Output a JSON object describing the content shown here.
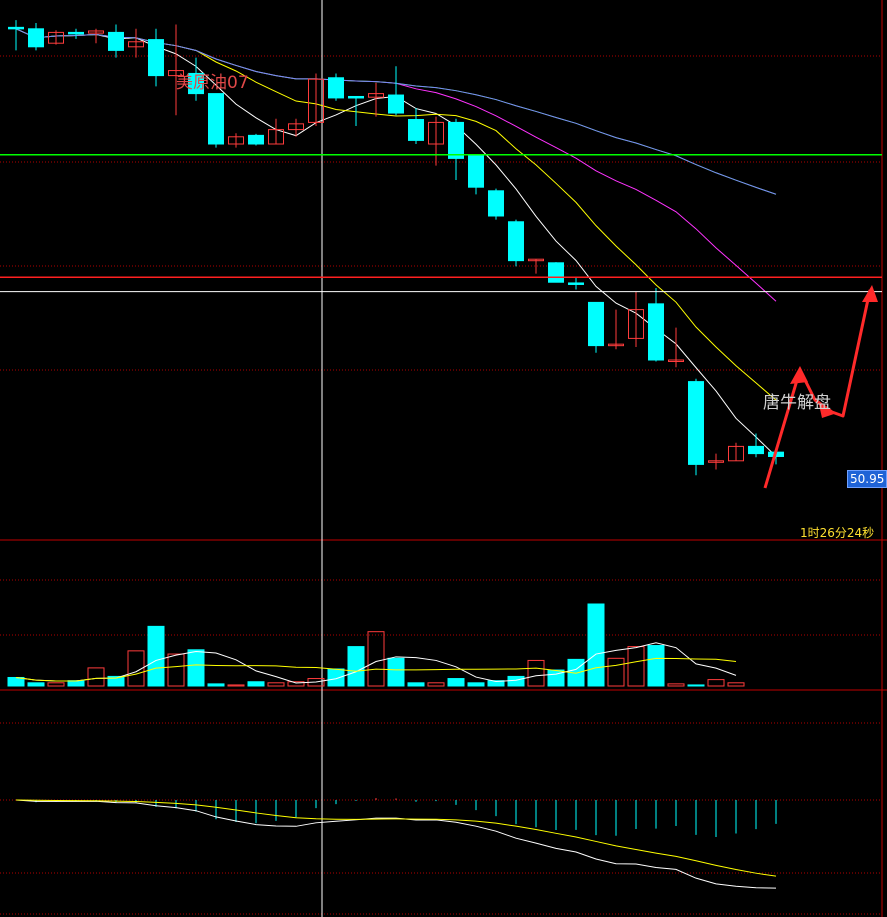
{
  "chart_data": {
    "type": "candlestick",
    "title": "美原油07",
    "last_price_label": "50.95",
    "countdown": "1时26分24秒",
    "watermark": "唐牛解盘",
    "candles": [
      {
        "o": 54.62,
        "h": 54.72,
        "l": 54.3,
        "c": 54.6
      },
      {
        "o": 54.6,
        "h": 54.68,
        "l": 54.3,
        "c": 54.35
      },
      {
        "o": 54.4,
        "h": 54.58,
        "l": 54.38,
        "c": 54.55
      },
      {
        "o": 54.55,
        "h": 54.6,
        "l": 54.46,
        "c": 54.53
      },
      {
        "o": 54.54,
        "h": 54.6,
        "l": 54.4,
        "c": 54.57
      },
      {
        "o": 54.55,
        "h": 54.66,
        "l": 54.2,
        "c": 54.3
      },
      {
        "o": 54.35,
        "h": 54.6,
        "l": 54.2,
        "c": 54.42
      },
      {
        "o": 54.45,
        "h": 54.6,
        "l": 53.8,
        "c": 53.95
      },
      {
        "o": 53.95,
        "h": 54.66,
        "l": 53.4,
        "c": 54.02
      },
      {
        "o": 53.98,
        "h": 54.2,
        "l": 53.6,
        "c": 53.7
      },
      {
        "o": 53.7,
        "h": 53.7,
        "l": 52.95,
        "c": 53.0
      },
      {
        "o": 53.0,
        "h": 53.15,
        "l": 52.95,
        "c": 53.1
      },
      {
        "o": 53.12,
        "h": 53.14,
        "l": 52.98,
        "c": 53.0
      },
      {
        "o": 53.0,
        "h": 53.35,
        "l": 53.0,
        "c": 53.2
      },
      {
        "o": 53.2,
        "h": 53.35,
        "l": 53.1,
        "c": 53.28
      },
      {
        "o": 53.3,
        "h": 53.98,
        "l": 53.25,
        "c": 53.9
      },
      {
        "o": 53.92,
        "h": 53.98,
        "l": 53.6,
        "c": 53.64
      },
      {
        "o": 53.66,
        "h": 53.66,
        "l": 53.25,
        "c": 53.64
      },
      {
        "o": 53.65,
        "h": 53.85,
        "l": 53.38,
        "c": 53.7
      },
      {
        "o": 53.68,
        "h": 54.08,
        "l": 53.4,
        "c": 53.43
      },
      {
        "o": 53.34,
        "h": 53.5,
        "l": 53.0,
        "c": 53.05
      },
      {
        "o": 53.0,
        "h": 53.38,
        "l": 52.7,
        "c": 53.3
      },
      {
        "o": 53.3,
        "h": 53.35,
        "l": 52.5,
        "c": 52.8
      },
      {
        "o": 52.85,
        "h": 52.85,
        "l": 52.3,
        "c": 52.4
      },
      {
        "o": 52.35,
        "h": 52.38,
        "l": 51.95,
        "c": 52.0
      },
      {
        "o": 51.92,
        "h": 51.95,
        "l": 51.3,
        "c": 51.38
      },
      {
        "o": 51.38,
        "h": 51.4,
        "l": 51.2,
        "c": 51.4
      },
      {
        "o": 51.35,
        "h": 51.36,
        "l": 51.18,
        "c": 51.08
      },
      {
        "o": 51.07,
        "h": 51.14,
        "l": 50.98,
        "c": 51.05
      },
      {
        "o": 50.8,
        "h": 50.8,
        "l": 50.1,
        "c": 50.2
      },
      {
        "o": 50.2,
        "h": 50.7,
        "l": 50.15,
        "c": 50.22
      },
      {
        "o": 50.3,
        "h": 50.95,
        "l": 50.18,
        "c": 50.7
      },
      {
        "o": 50.78,
        "h": 51.0,
        "l": 49.98,
        "c": 50.0
      },
      {
        "o": 50.0,
        "h": 50.45,
        "l": 49.9,
        "c": 50.0
      },
      {
        "o": 49.7,
        "h": 49.74,
        "l": 48.4,
        "c": 48.55
      },
      {
        "o": 48.58,
        "h": 48.7,
        "l": 48.48,
        "c": 48.6
      },
      {
        "o": 48.6,
        "h": 48.85,
        "l": 48.6,
        "c": 48.8
      },
      {
        "o": 48.8,
        "h": 48.98,
        "l": 48.65,
        "c": 48.7
      },
      {
        "o": 48.72,
        "h": 48.78,
        "l": 48.55,
        "c": 48.66
      }
    ],
    "volume": [
      8,
      3,
      3,
      5,
      17,
      9,
      33,
      56,
      30,
      34,
      2,
      1,
      4,
      3,
      4,
      7,
      16,
      37,
      51,
      26,
      3,
      3,
      7,
      3,
      5,
      9,
      24,
      15,
      25,
      77,
      26,
      37,
      38,
      2,
      1,
      6,
      3
    ],
    "reference_lines": [
      {
        "name": "green",
        "value": 52.85,
        "color": "#00ff00"
      },
      {
        "name": "red",
        "value": 51.15,
        "color": "#ff2020"
      },
      {
        "name": "white",
        "value": 50.95,
        "color": "#ffffff"
      }
    ],
    "colors": {
      "up": "#ff3c3c",
      "down": "#00ffff",
      "bg": "#000000",
      "grid": "#c00000"
    }
  }
}
